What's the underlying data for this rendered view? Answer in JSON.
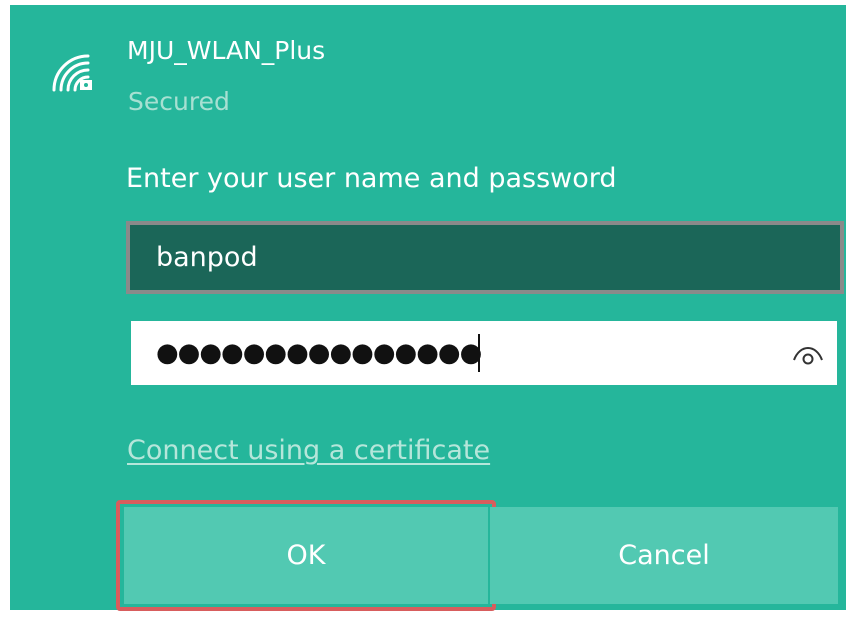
{
  "network": {
    "name": "MJU_WLAN_Plus",
    "status": "Secured",
    "icon": "wifi-secured-icon"
  },
  "form": {
    "prompt": "Enter your user name and password",
    "username_value": "banpod",
    "password_masked": "●●●●●●●●●●●●●●●",
    "reveal_icon": "eye-icon"
  },
  "links": {
    "certificate": "Connect using a certificate"
  },
  "buttons": {
    "ok": "OK",
    "cancel": "Cancel"
  },
  "colors": {
    "panel_bg": "#25b69b",
    "username_bg": "#1b6658",
    "button_bg": "#52c9b2",
    "highlight": "#d85d5d"
  }
}
